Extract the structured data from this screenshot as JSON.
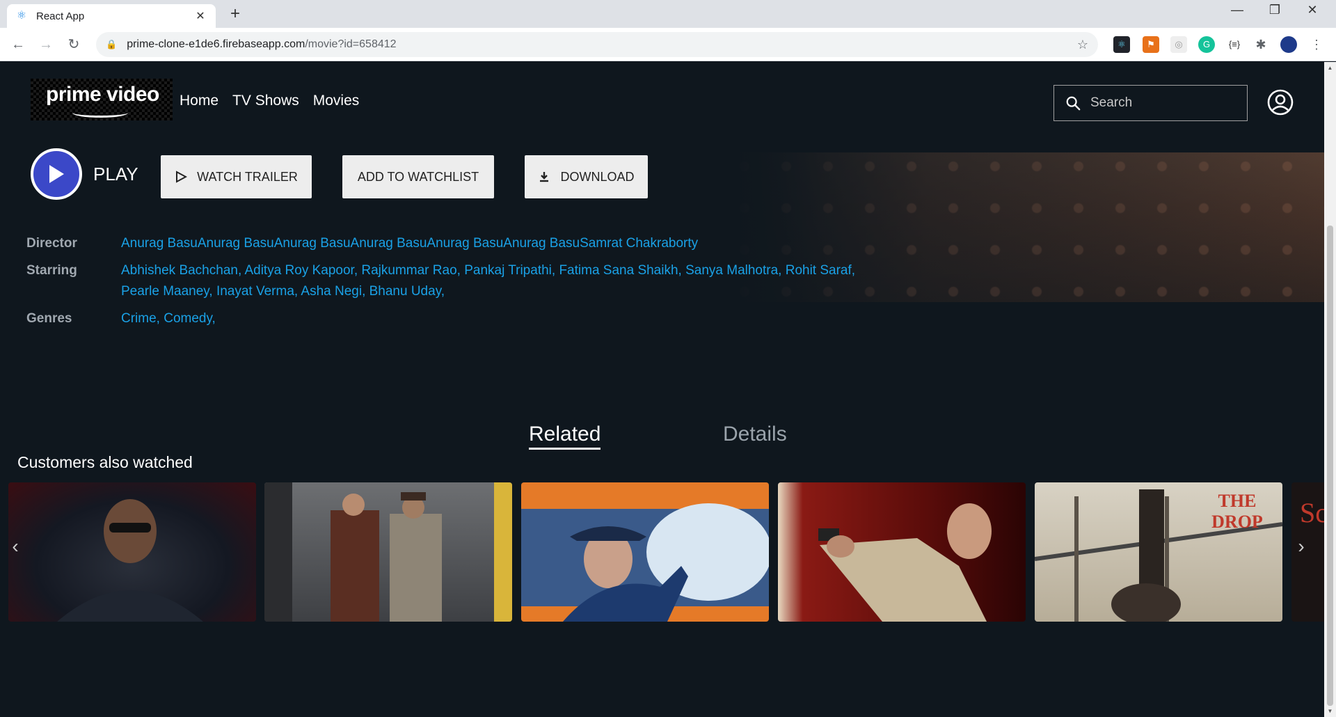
{
  "browser": {
    "tab_title": "React App",
    "url_host": "prime-clone-e1de6.firebaseapp.com",
    "url_path": "/movie?id=658412"
  },
  "header": {
    "logo_text": "prime video",
    "nav": [
      "Home",
      "TV Shows",
      "Movies"
    ],
    "search_placeholder": "Search"
  },
  "actions": {
    "play_label": "PLAY",
    "watch_trailer": "WATCH TRAILER",
    "add_watchlist": "ADD TO WATCHLIST",
    "download": "DOWNLOAD"
  },
  "details": {
    "director_label": "Director",
    "director_value": "Anurag BasuAnurag BasuAnurag BasuAnurag BasuAnurag BasuAnurag BasuSamrat Chakraborty",
    "starring_label": "Starring",
    "starring_line1": "Abhishek Bachchan, Aditya Roy Kapoor, Rajkummar Rao, Pankaj Tripathi, Fatima Sana Shaikh, Sanya Malhotra, Rohit Saraf,",
    "starring_line2": "Pearle Maaney, Inayat Verma, Asha Negi, Bhanu Uday,",
    "genres_label": "Genres",
    "genres_value": "Crime, Comedy,"
  },
  "tabs": {
    "related": "Related",
    "details": "Details"
  },
  "row": {
    "title": "Customers also watched",
    "cards": [
      {
        "poster_text": ""
      },
      {
        "poster_text": ""
      },
      {
        "poster_text": ""
      },
      {
        "poster_text": ""
      },
      {
        "poster_text": "THE DROP"
      }
    ],
    "partial_card_text": "Sc"
  },
  "colors": {
    "background": "#0f171e",
    "link": "#1aa1e6",
    "play_blue": "#3b48c8"
  }
}
